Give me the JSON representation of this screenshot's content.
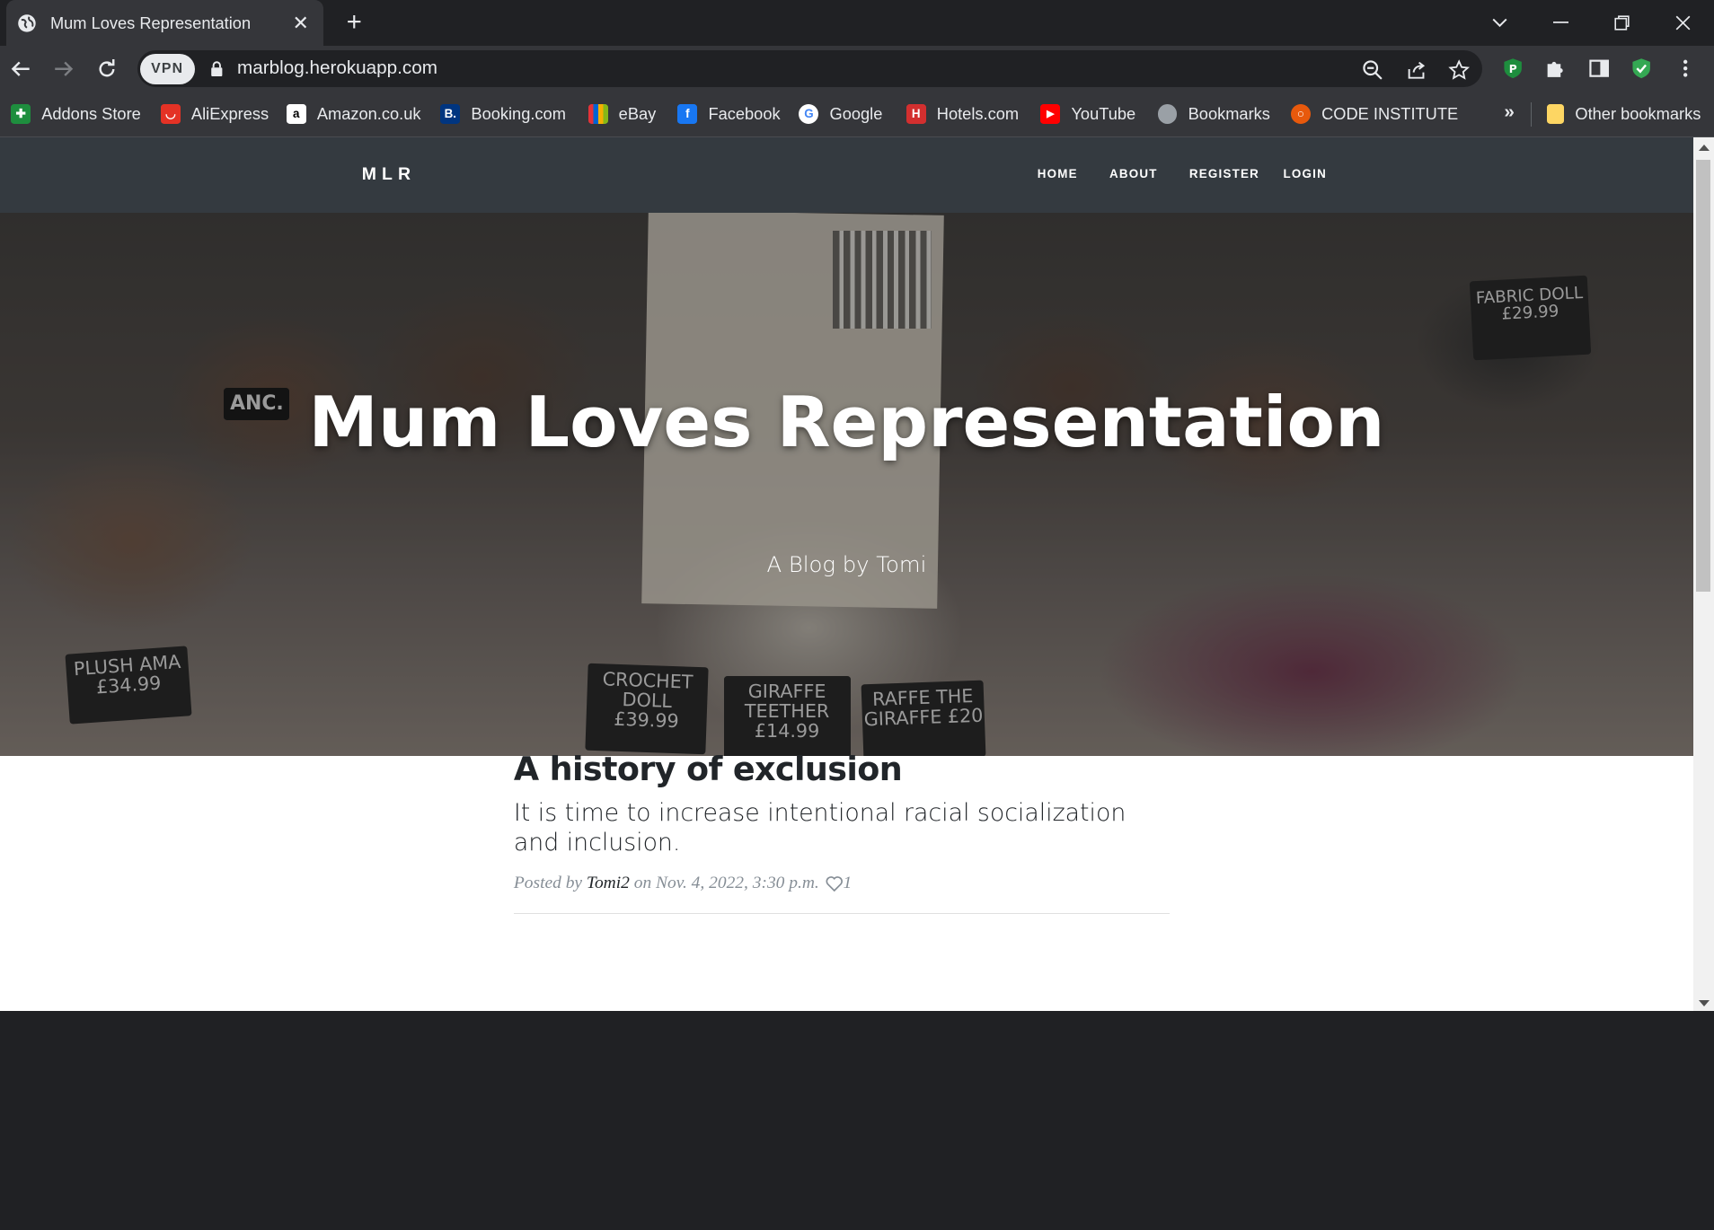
{
  "browser": {
    "tab_title": "Mum Loves Representation",
    "url": "marblog.herokuapp.com",
    "vpn_label": "VPN",
    "bookmarks": [
      {
        "label": "Addons Store",
        "icon": "addons-store-icon",
        "color": "#1e8e3e"
      },
      {
        "label": "AliExpress",
        "icon": "aliexpress-icon",
        "color": "#e43225"
      },
      {
        "label": "Amazon.co.uk",
        "icon": "amazon-icon",
        "color": "#ffffff"
      },
      {
        "label": "Booking.com",
        "icon": "booking-icon",
        "color": "#003580"
      },
      {
        "label": "eBay",
        "icon": "ebay-icon",
        "color": "#f5af02"
      },
      {
        "label": "Facebook",
        "icon": "facebook-icon",
        "color": "#1877f2"
      },
      {
        "label": "Google",
        "icon": "google-icon",
        "color": "#ffffff"
      },
      {
        "label": "Hotels.com",
        "icon": "hotels-icon",
        "color": "#d32f2f"
      },
      {
        "label": "YouTube",
        "icon": "youtube-icon",
        "color": "#ff0000"
      },
      {
        "label": "Bookmarks",
        "icon": "globe-icon",
        "color": "#9aa0a6"
      },
      {
        "label": "CODE INSTITUTE",
        "icon": "code-institute-icon",
        "color": "#e8590c"
      }
    ],
    "more_bookmarks": "»",
    "other_bookmarks": "Other bookmarks"
  },
  "site": {
    "brand": "MLR",
    "nav": [
      "HOME",
      "ABOUT",
      "REGISTER",
      "LOGIN"
    ],
    "hero_title": "Mum Loves Representation",
    "hero_subtitle": "A Blog by Tomi"
  },
  "hero_signs": {
    "plush": "PLUSH AMA £34.99",
    "crochet": "CROCHET DOLL £39.99",
    "teether": "GIRAFFE TEETHER £14.99",
    "raffe": "RAFFE THE GIRAFFE £20",
    "fabric": "FABRIC DOLL £29.99",
    "shirt": "ANC."
  },
  "post": {
    "title": "A history of exclusion",
    "subtitle": "It is time to increase intentional racial socialization and inclusion.",
    "posted_by": "Posted by",
    "author": "Tomi2",
    "date_text": "on Nov. 4, 2022, 3:30 p.m.",
    "likes": "1"
  },
  "colors": {
    "chrome_dark": "#202124",
    "chrome_toolbar": "#35363a",
    "site_nav": "#343a40",
    "text_dark": "#212529",
    "meta_gray": "#868e96"
  }
}
